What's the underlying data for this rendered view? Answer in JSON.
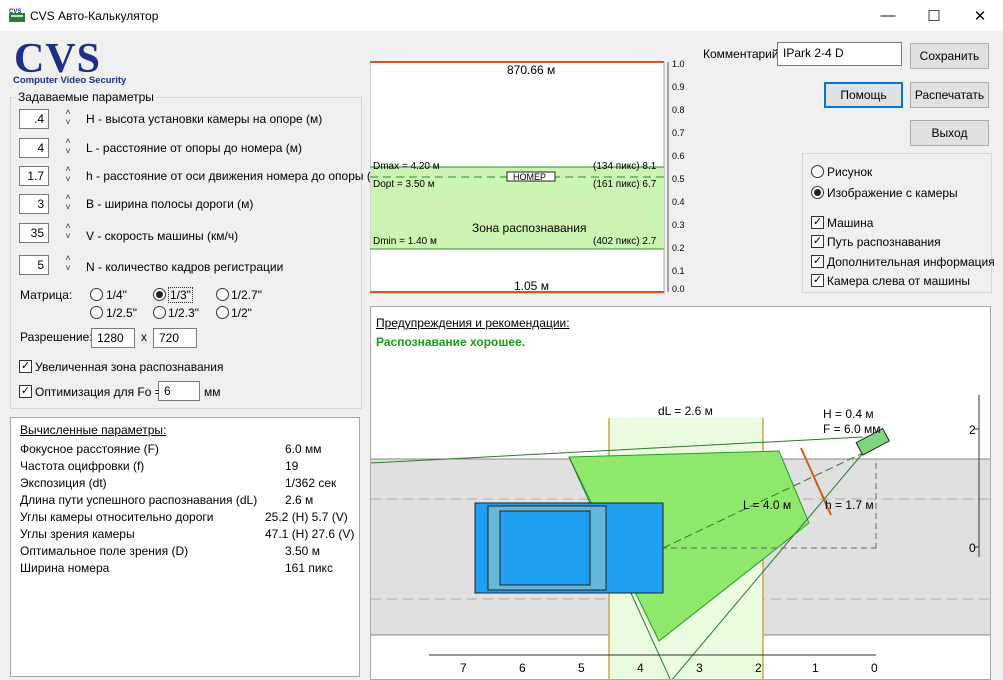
{
  "window": {
    "title": "CVS Авто-Калькулятор",
    "minimize": "—",
    "maximize": "☐",
    "close": "✕"
  },
  "logo": {
    "text": "CVS",
    "sub": "Computer Video Security"
  },
  "params": {
    "legend": "Задаваемые параметры",
    "rows": [
      {
        "value": ".4",
        "label": "H - высота установки камеры на опоре (м)"
      },
      {
        "value": "4",
        "label": "L - расстояние от опоры до номера (м)"
      },
      {
        "value": "1.7",
        "label": "h - расстояние от оси движения номера до опоры (м)"
      },
      {
        "value": "3",
        "label": "B - ширина полосы дороги (м)"
      },
      {
        "value": "35",
        "label": "V - скорость машины (км/ч)"
      },
      {
        "value": "5",
        "label": "N - количество кадров регистрации"
      }
    ],
    "matrix_label": "Матрица:",
    "matrix": [
      "1/4\"",
      "1/3\"",
      "1/2.7\"",
      "1/2.5\"",
      "1/2.3\"",
      "1/2\""
    ],
    "matrix_selected": "1/3\"",
    "res_label": "Разрешение:",
    "res_w": "1280",
    "res_x": "x",
    "res_h": "720",
    "enlarged_zone": "Увеличенная зона распознавания",
    "optimize_label": "Оптимизация для Fo =",
    "optimize_value": "6",
    "optimize_unit": "мм"
  },
  "computed": {
    "title": "Вычисленные параметры:",
    "rows": [
      {
        "label": "Фокусное расстояние (F)",
        "value": "6.0 мм"
      },
      {
        "label": "Частота оцифровки (f)",
        "value": "19"
      },
      {
        "label": "Экспозиция (dt)",
        "value": "1/362 сек"
      },
      {
        "label": "Длина пути успешного распознавания (dL)",
        "value": "2.6 м"
      },
      {
        "label": "Углы камеры относительно дороги",
        "value": "25.2 (H) 5.7 (V)"
      },
      {
        "label": "Углы зрения камеры",
        "value": "47.1 (H) 27.6 (V)"
      },
      {
        "label": "Оптимальное поле зрения (D)",
        "value": "3.50 м"
      },
      {
        "label": "Ширина номера",
        "value": "161 пикс"
      }
    ]
  },
  "preview": {
    "top_distance": "870.66 м",
    "bottom_distance": "1.05 м",
    "scale": [
      "1.0",
      "0.9",
      "0.8",
      "0.7",
      "0.6",
      "0.5",
      "0.4",
      "0.3",
      "0.2",
      "0.1",
      "0.0"
    ],
    "dmax": "Dmax = 4.20 м",
    "dmax_px": "(134 пикс) 8.1",
    "dopt": "Dopt = 3.50 м",
    "dopt_px": "(161 пикс) 6.7",
    "dmin": "Dmin = 1.40 м",
    "dmin_px": "(402 пикс) 2.7",
    "plate": "НОМЕР",
    "zone": "Зона распознавания"
  },
  "comment": {
    "label": "Комментарий",
    "value": "IPark 2-4 D"
  },
  "buttons": {
    "save": "Сохранить",
    "help": "Помощь",
    "print": "Распечатать",
    "exit": "Выход"
  },
  "options": {
    "view_picture": "Рисунок",
    "view_camera": "Изображение с камеры",
    "car": "Машина",
    "path": "Путь распознавания",
    "extra": "Дополнительная информация",
    "camera_left": "Камера слева от машины"
  },
  "diagram": {
    "warnings_title": "Предупреждения и рекомендации:",
    "status": "Распознавание хорошее.",
    "dL": "dL = 2.6 м",
    "H": "H = 0.4 м",
    "F": "F = 6.0 мм",
    "L": "L = 4.0 м",
    "h": "h = 1.7 м",
    "x_ticks": [
      "7",
      "6",
      "5",
      "4",
      "3",
      "2",
      "1",
      "0"
    ],
    "y_ticks": [
      "2",
      "0"
    ]
  },
  "colors": {
    "zone_green": "#ccf5b3",
    "cone_green": "#8ee86b",
    "car_blue": "#1e9ff0",
    "accent": "#0078d7",
    "status_green": "#1f9a1f"
  }
}
